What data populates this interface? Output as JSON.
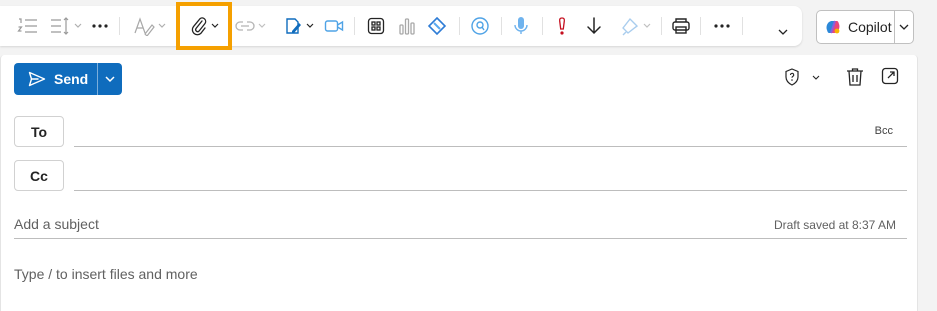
{
  "toolbar": {
    "icons": [
      "numbered-list-icon",
      "line-spacing-icon",
      "more-icon",
      "styles-icon",
      "attach-file-icon",
      "link-icon",
      "signature-icon",
      "meeting-icon",
      "apps-icon",
      "insights-icon",
      "loop-icon",
      "viva-icon",
      "dictate-icon",
      "high-importance-icon",
      "low-importance-icon",
      "sensitivity-icon",
      "print-icon",
      "more-options-icon",
      "expand-ribbon-icon"
    ]
  },
  "copilot": {
    "label": "Copilot"
  },
  "compose": {
    "send_label": "Send",
    "to_label": "To",
    "cc_label": "Cc",
    "bcc_label": "Bcc",
    "subject_placeholder": "Add a subject",
    "draft_status": "Draft saved at 8:37 AM",
    "body_placeholder": "Type / to insert files and more"
  },
  "colors": {
    "accent": "#0f6cbd",
    "highlight": "#f5a000",
    "importance": "#c50f1f"
  }
}
